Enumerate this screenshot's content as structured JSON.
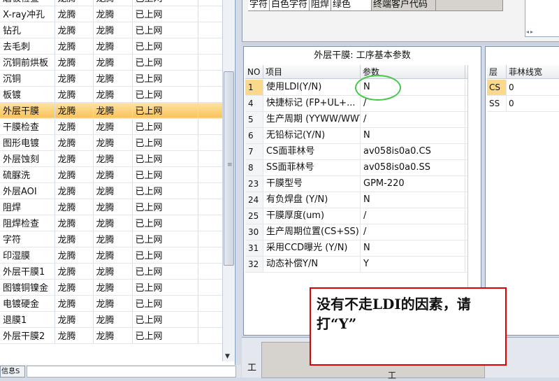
{
  "left_list": {
    "rows": [
      {
        "process": "磨板检查",
        "factory1": "龙腾",
        "factory2": "龙腾",
        "status": "已上网"
      },
      {
        "process": "X-ray冲孔",
        "factory1": "龙腾",
        "factory2": "龙腾",
        "status": "已上网"
      },
      {
        "process": "钻孔",
        "factory1": "龙腾",
        "factory2": "龙腾",
        "status": "已上网"
      },
      {
        "process": "去毛刺",
        "factory1": "龙腾",
        "factory2": "龙腾",
        "status": "已上网"
      },
      {
        "process": "沉铜前烘板",
        "factory1": "龙腾",
        "factory2": "龙腾",
        "status": "已上网"
      },
      {
        "process": "沉铜",
        "factory1": "龙腾",
        "factory2": "龙腾",
        "status": "已上网"
      },
      {
        "process": "板镀",
        "factory1": "龙腾",
        "factory2": "龙腾",
        "status": "已上网"
      },
      {
        "process": "外层干膜",
        "factory1": "龙腾",
        "factory2": "龙腾",
        "status": "已上网",
        "selected": true
      },
      {
        "process": "干膜检查",
        "factory1": "龙腾",
        "factory2": "龙腾",
        "status": "已上网"
      },
      {
        "process": "图形电镀",
        "factory1": "龙腾",
        "factory2": "龙腾",
        "status": "已上网"
      },
      {
        "process": "外层蚀刻",
        "factory1": "龙腾",
        "factory2": "龙腾",
        "status": "已上网"
      },
      {
        "process": "硫脲洗",
        "factory1": "龙腾",
        "factory2": "龙腾",
        "status": "已上网"
      },
      {
        "process": "外层AOI",
        "factory1": "龙腾",
        "factory2": "龙腾",
        "status": "已上网"
      },
      {
        "process": "阻焊",
        "factory1": "龙腾",
        "factory2": "龙腾",
        "status": "已上网"
      },
      {
        "process": "阻焊检查",
        "factory1": "龙腾",
        "factory2": "龙腾",
        "status": "已上网"
      },
      {
        "process": "字符",
        "factory1": "龙腾",
        "factory2": "龙腾",
        "status": "已上网"
      },
      {
        "process": "印湿膜",
        "factory1": "龙腾",
        "factory2": "龙腾",
        "status": "已上网"
      },
      {
        "process": "外层干膜1",
        "factory1": "龙腾",
        "factory2": "龙腾",
        "status": "已上网"
      },
      {
        "process": "图镀铜镍金",
        "factory1": "龙腾",
        "factory2": "龙腾",
        "status": "已上网"
      },
      {
        "process": "电镀硬金",
        "factory1": "龙腾",
        "factory2": "龙腾",
        "status": "已上网"
      },
      {
        "process": "退膜1",
        "factory1": "龙腾",
        "factory2": "龙腾",
        "status": "已上网"
      },
      {
        "process": "外层干膜2",
        "factory1": "龙腾",
        "factory2": "龙腾",
        "status": "已上网"
      }
    ],
    "bottom_tab_label": "信息S"
  },
  "top_tabs": [
    "字符",
    "白色字符",
    "阻焊",
    "绿色",
    "终端客户代码"
  ],
  "params": {
    "title": "外层干膜: 工序基本参数",
    "headers": {
      "no": "NO",
      "name": "项目",
      "value": "参数"
    },
    "rows": [
      {
        "no": "1",
        "name": "使用LDI(Y/N)",
        "value": "N"
      },
      {
        "no": "4",
        "name": "快捷标记 (FP+UL+...",
        "value": "/"
      },
      {
        "no": "5",
        "name": "生产周期 (YYWW/WWYY)",
        "value": "/"
      },
      {
        "no": "6",
        "name": "无铅标记(Y/N)",
        "value": "N"
      },
      {
        "no": "7",
        "name": "CS面菲林号",
        "value": "av058is0a0.CS"
      },
      {
        "no": "8",
        "name": "SS面菲林号",
        "value": "av058is0a0.SS"
      },
      {
        "no": "23",
        "name": "干膜型号",
        "value": "GPM-220"
      },
      {
        "no": "24",
        "name": "有负焊盘 (Y/N)",
        "value": "N"
      },
      {
        "no": "25",
        "name": "干膜厚度(um)",
        "value": "/"
      },
      {
        "no": "30",
        "name": "生产周期位置(CS+SS)",
        "value": "/"
      },
      {
        "no": "31",
        "name": "采用CCD曝光 (Y/N)",
        "value": "N"
      },
      {
        "no": "32",
        "name": "动态补偿Y/N",
        "value": "Y"
      }
    ]
  },
  "layers": {
    "headers": {
      "layer": "层",
      "width": "菲林线宽"
    },
    "rows": [
      {
        "layer": "CS",
        "width": "0"
      },
      {
        "layer": "SS",
        "width": "0"
      }
    ]
  },
  "bottom": {
    "label_left": "工",
    "label_right": "工"
  },
  "annotation": {
    "note_text": "没有不走LDI的因素，请打“Y”",
    "circle_color": "#45c84a",
    "box_border_color": "#e00000"
  },
  "colors": {
    "selected_row": "#fbd98b",
    "accent_border": "#7f9db9"
  }
}
